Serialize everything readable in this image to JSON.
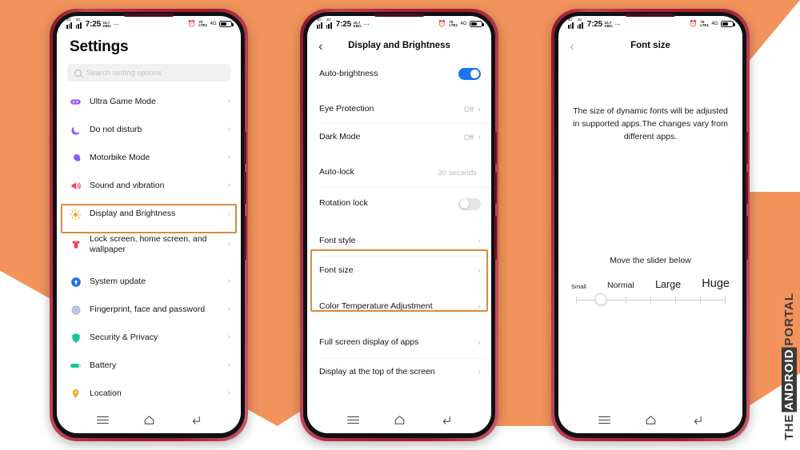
{
  "watermark": {
    "pre": "THE ",
    "box": "ANDROID",
    "post": " PORTAL"
  },
  "status_bar": {
    "network_label_1": "4G",
    "network_label_2": "4G",
    "time": "7:25",
    "mini_top": "10.7",
    "mini_bottom": "KB/s",
    "overflow_dots": "···",
    "alarm_icon": "alarm-icon",
    "data_icon": "data-speed-icon",
    "volte_icon": "volte-icon",
    "battery_icon": "battery-icon"
  },
  "nav_bar": {
    "recents_label": "recents",
    "home_label": "home",
    "back_label": "back"
  },
  "phone1": {
    "page_title": "Settings",
    "search": {
      "placeholder": "Search setting options",
      "icon": "search-icon"
    },
    "items": [
      {
        "label": "Ultra Game Mode",
        "icon": "game-controller-icon",
        "color": "#9B5CF6",
        "chevron": "›"
      },
      {
        "label": "Do not disturb",
        "icon": "moon-icon",
        "color": "#8E5BF0",
        "chevron": "›"
      },
      {
        "label": "Motorbike Mode",
        "icon": "helmet-icon",
        "color": "#8E5BF0",
        "chevron": "›"
      },
      {
        "label": "Sound and vibration",
        "icon": "speaker-icon",
        "color": "#F2415C",
        "chevron": "›"
      },
      {
        "label": "Display and Brightness",
        "icon": "sun-icon",
        "color": "#F5A623",
        "chevron": "›",
        "highlighted": true
      },
      {
        "label": "Lock screen, home screen, and wallpaper",
        "icon": "shirt-icon",
        "color": "#F2415C",
        "chevron": "›"
      },
      {
        "label": "System update",
        "icon": "arrow-up-circle-icon",
        "color": "#1F6FEB",
        "chevron": "›"
      },
      {
        "label": "Fingerprint, face and password",
        "icon": "fingerprint-icon",
        "color": "#7B93B8",
        "chevron": "›"
      },
      {
        "label": "Security & Privacy",
        "icon": "shield-icon",
        "color": "#16C79A",
        "chevron": "›"
      },
      {
        "label": "Battery",
        "icon": "battery-icon",
        "color": "#16C79A",
        "chevron": "›"
      },
      {
        "label": "Location",
        "icon": "map-pin-icon",
        "color": "#F5A623",
        "chevron": "›"
      }
    ]
  },
  "phone2": {
    "header_title": "Display and Brightness",
    "back_icon": "chevron-left-icon",
    "items": [
      {
        "label": "Auto-brightness",
        "control": "toggle",
        "state": "on"
      },
      {
        "label": "Eye Protection",
        "value": "Off",
        "chevron": "›"
      },
      {
        "label": "Dark Mode",
        "value": "Off",
        "chevron": "›"
      },
      {
        "label": "Auto-lock",
        "value": "30 seconds"
      },
      {
        "label": "Rotation lock",
        "control": "toggle",
        "state": "off"
      },
      {
        "label": "Font style",
        "chevron": "›",
        "highlighted": true
      },
      {
        "label": "Font size",
        "chevron": "›",
        "highlighted": true
      },
      {
        "label": "Color Temperature Adjustment",
        "chevron": "›"
      },
      {
        "label": "Full screen display of apps",
        "chevron": "›"
      },
      {
        "label": "Display at the top of the screen",
        "chevron": "›"
      }
    ]
  },
  "phone3": {
    "header_title": "Font size",
    "back_icon": "chevron-left-icon",
    "description": "The size of dynamic fonts will be adjusted in supported apps.The changes vary from different apps.",
    "slider_hint": "Move the slider below",
    "slider": {
      "labels": [
        "Small",
        "Normal",
        "Large",
        "Huge"
      ],
      "tick_count": 7,
      "selected_index": 1,
      "selected_label": "Normal"
    }
  },
  "theme": {
    "background": "#F2935C",
    "highlight_border": "#D98A42",
    "toggle_on": "#1877F2",
    "frame": "#AA1F38"
  }
}
